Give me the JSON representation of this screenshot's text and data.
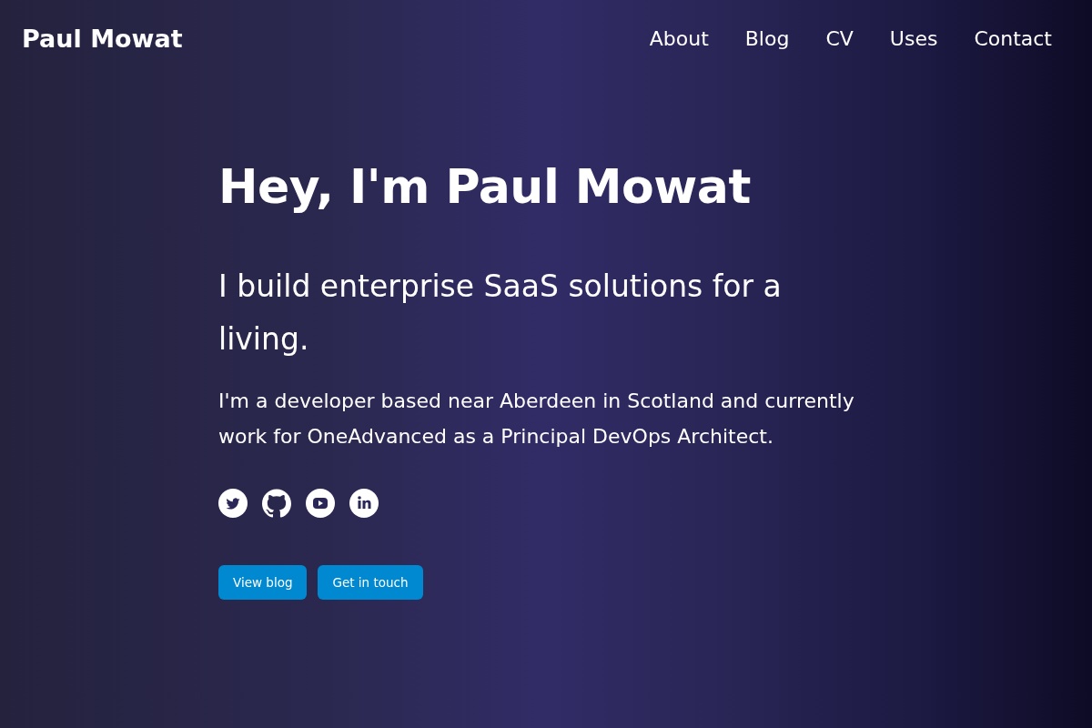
{
  "header": {
    "site_title": "Paul Mowat",
    "nav": [
      {
        "label": "About"
      },
      {
        "label": "Blog"
      },
      {
        "label": "CV"
      },
      {
        "label": "Uses"
      },
      {
        "label": "Contact"
      }
    ]
  },
  "hero": {
    "heading": "Hey, I'm Paul Mowat",
    "tagline": "I build enterprise SaaS solutions for a living.",
    "intro": "I'm a developer based near Aberdeen in Scotland and currently work for OneAdvanced as a Principal DevOps Architect.",
    "social_links": [
      {
        "kind": "twitter"
      },
      {
        "kind": "github"
      },
      {
        "kind": "youtube"
      },
      {
        "kind": "linkedin"
      }
    ],
    "buttons": [
      "View blog",
      "Get in touch"
    ]
  }
}
